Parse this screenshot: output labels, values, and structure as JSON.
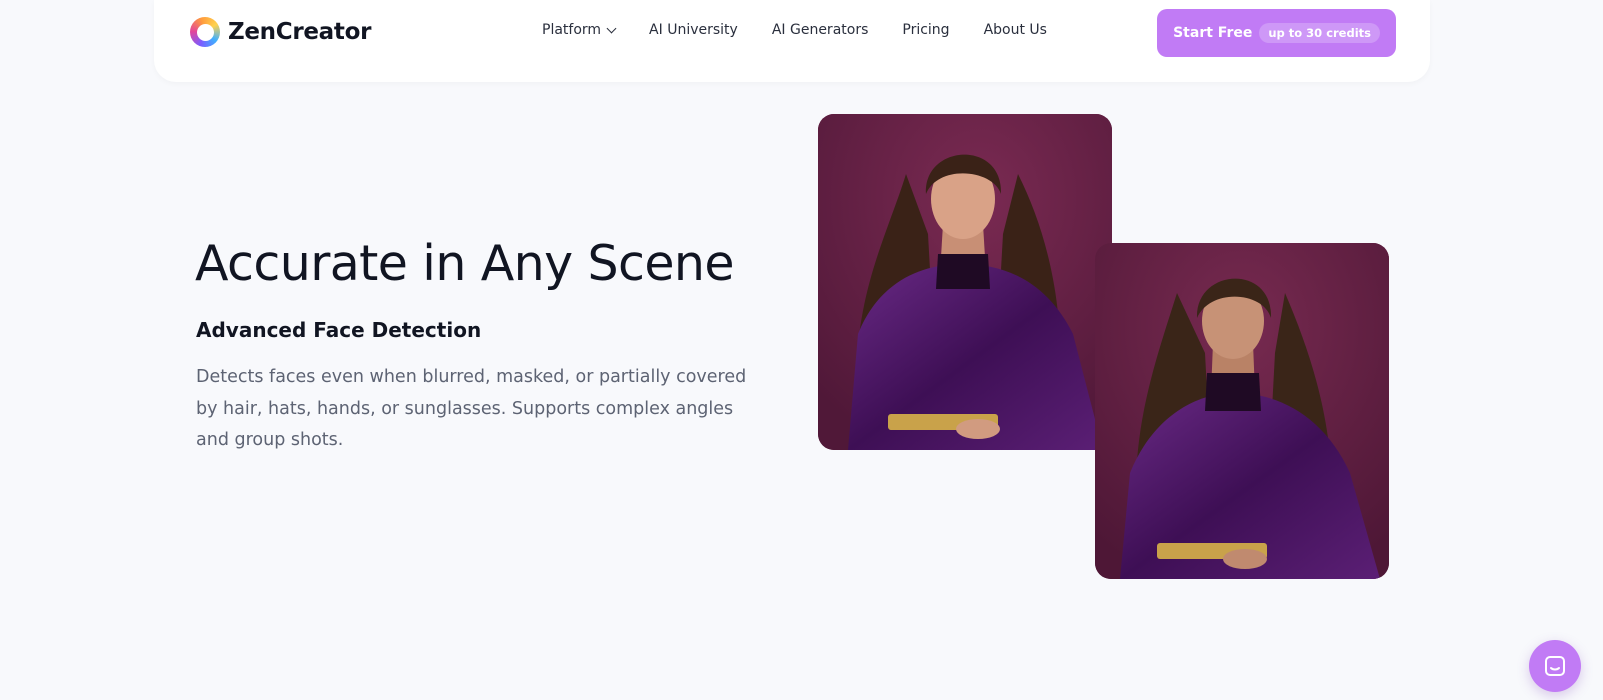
{
  "header": {
    "logo_text": "ZenCreator",
    "nav": [
      {
        "label": "Platform",
        "has_dropdown": true
      },
      {
        "label": "AI University"
      },
      {
        "label": "AI Generators"
      },
      {
        "label": "Pricing"
      },
      {
        "label": "About Us"
      }
    ],
    "cta": {
      "label": "Start Free",
      "badge": "up to 30 credits"
    }
  },
  "hero": {
    "title": "Accurate in Any Scene",
    "subtitle": "Advanced Face Detection",
    "description": "Detects faces even when blurred, masked, or partially covered by hair, hats, hands, or sunglasses. Supports complex angles and group shots."
  },
  "images": [
    {
      "icon": "portrait-woman-purple-velvet-suit-1"
    },
    {
      "icon": "portrait-woman-purple-velvet-suit-2"
    }
  ],
  "chat": {
    "icon": "chat-icon"
  },
  "colors": {
    "background": "#f8f9fc",
    "accent": "#c17bf5",
    "photo_backdrop": "#5d1e40",
    "suit": "#4b1560"
  }
}
